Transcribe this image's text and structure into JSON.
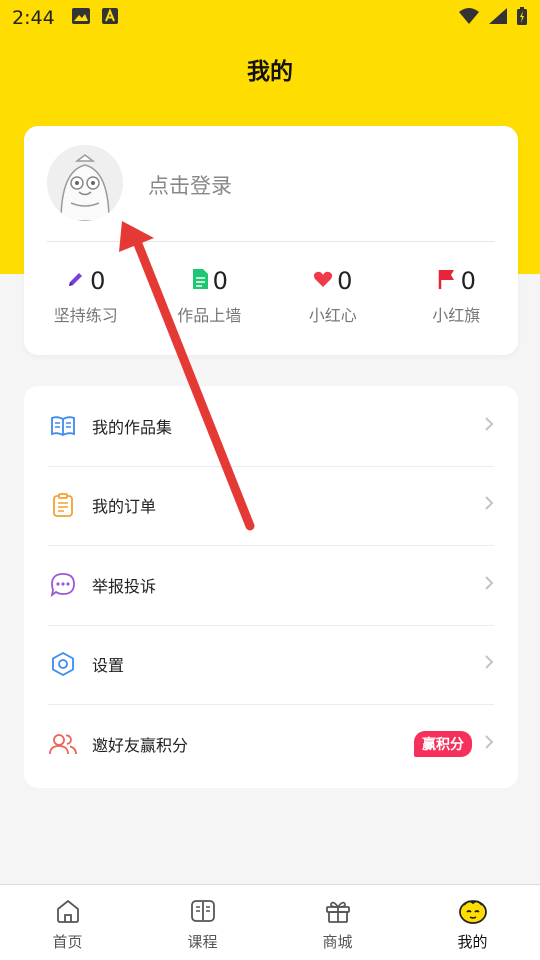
{
  "status_bar": {
    "time": "2:44",
    "left_icons": [
      "image-icon",
      "a-text-icon"
    ],
    "right_icons": [
      "wifi-icon",
      "signal-icon",
      "battery-charging-icon"
    ]
  },
  "header": {
    "title": "我的"
  },
  "profile": {
    "login_text": "点击登录",
    "stats": [
      {
        "icon": "pencil-icon",
        "color": "#7B3FD9",
        "value": "0",
        "label": "坚持练习"
      },
      {
        "icon": "document-icon",
        "color": "#1EC873",
        "value": "0",
        "label": "作品上墙"
      },
      {
        "icon": "heart-icon",
        "color": "#F03A4A",
        "value": "0",
        "label": "小红心"
      },
      {
        "icon": "flag-icon",
        "color": "#E8243A",
        "value": "0",
        "label": "小红旗"
      }
    ]
  },
  "menu": {
    "items": [
      {
        "icon": "open-book-icon",
        "color": "#3D8BEF",
        "label": "我的作品集"
      },
      {
        "icon": "clipboard-icon",
        "color": "#F2A233",
        "label": "我的订单"
      },
      {
        "icon": "chat-bubble-icon",
        "color": "#9B59D6",
        "label": "举报投诉"
      },
      {
        "icon": "hexagon-settings-icon",
        "color": "#3D8BEF",
        "label": "设置"
      },
      {
        "icon": "users-icon",
        "color": "#F0625A",
        "label": "邀好友赢积分",
        "badge": "赢积分"
      }
    ]
  },
  "tab_bar": {
    "tabs": [
      {
        "icon": "home-icon",
        "label": "首页",
        "active": false
      },
      {
        "icon": "book-icon",
        "label": "课程",
        "active": false
      },
      {
        "icon": "gift-icon",
        "label": "商城",
        "active": false
      },
      {
        "icon": "face-icon",
        "label": "我的",
        "active": true
      }
    ]
  },
  "colors": {
    "header_bg": "#FFDD00",
    "badge_bg": "#F5305A",
    "annotation_arrow": "#E53935"
  }
}
